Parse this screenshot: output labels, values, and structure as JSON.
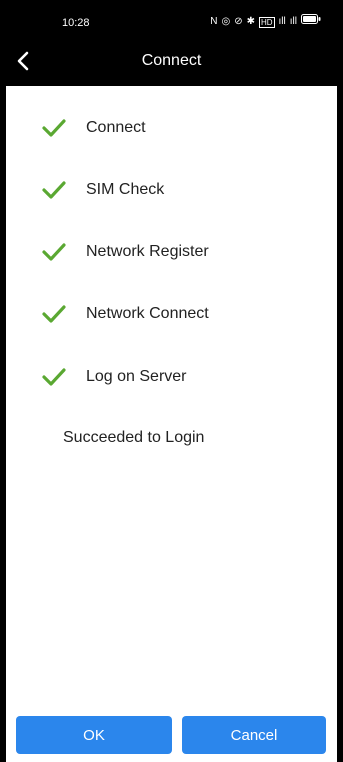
{
  "status_bar": {
    "time": "10:28",
    "icons": [
      "nfc-icon",
      "alarm-icon",
      "mute-icon",
      "bluetooth-icon",
      "hd-icon",
      "signal-icon",
      "signal-icon",
      "battery-icon"
    ],
    "icon_glyphs": [
      "N",
      "◎",
      "⊘",
      "✱",
      "HD",
      "ıll",
      "ıll",
      "▭"
    ]
  },
  "header": {
    "title": "Connect"
  },
  "steps": [
    {
      "label": "Connect",
      "status": "done"
    },
    {
      "label": "SIM Check",
      "status": "done"
    },
    {
      "label": "Network Register",
      "status": "done"
    },
    {
      "label": "Network Connect",
      "status": "done"
    },
    {
      "label": "Log on Server",
      "status": "done"
    }
  ],
  "result": "Succeeded to Login",
  "buttons": {
    "ok_label": "OK",
    "cancel_label": "Cancel"
  },
  "colors": {
    "check": "#5aa832",
    "button": "#2b86ec"
  }
}
